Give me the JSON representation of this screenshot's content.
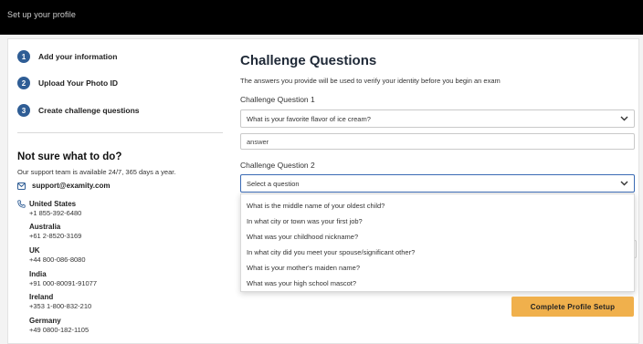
{
  "topbar": {
    "title": "Set up your profile"
  },
  "steps": [
    {
      "number": "1",
      "label": "Add your information"
    },
    {
      "number": "2",
      "label": "Upload Your Photo ID"
    },
    {
      "number": "3",
      "label": "Create challenge questions"
    }
  ],
  "support": {
    "title": "Not sure what to do?",
    "subtitle": "Our support team is available 24/7, 365 days a year.",
    "email": "support@examity.com",
    "countries": [
      {
        "name": "United States",
        "phone": "+1 855-392-6480"
      },
      {
        "name": "Australia",
        "phone": "+61 2-8520-3169"
      },
      {
        "name": "UK",
        "phone": "+44 800-086-8080"
      },
      {
        "name": "India",
        "phone": "+91 000-80091-91077"
      },
      {
        "name": "Ireland",
        "phone": "+353 1-800-832-210"
      },
      {
        "name": "Germany",
        "phone": "+49 0800-182-1105"
      }
    ]
  },
  "main": {
    "heading": "Challenge Questions",
    "description": "The answers you provide will be used to verify your identity before you begin an exam",
    "q1": {
      "label": "Challenge Question 1",
      "value": "What is your favorite flavor of ice cream?",
      "answer": "answer"
    },
    "q2": {
      "label": "Challenge Question 2",
      "value": "Select a question"
    },
    "dropdown_options": [
      "What is the middle name of your oldest child?",
      "In what city or town was your first job?",
      "What was your childhood nickname?",
      "In what city did you meet your spouse/significant other?",
      "What is your mother's maiden name?",
      "What was your high school mascot?"
    ],
    "submit_label": "Complete Profile Setup"
  },
  "colors": {
    "accent": "#2f5d95",
    "cta": "#f0b04c",
    "focus": "#3a6ab4"
  }
}
